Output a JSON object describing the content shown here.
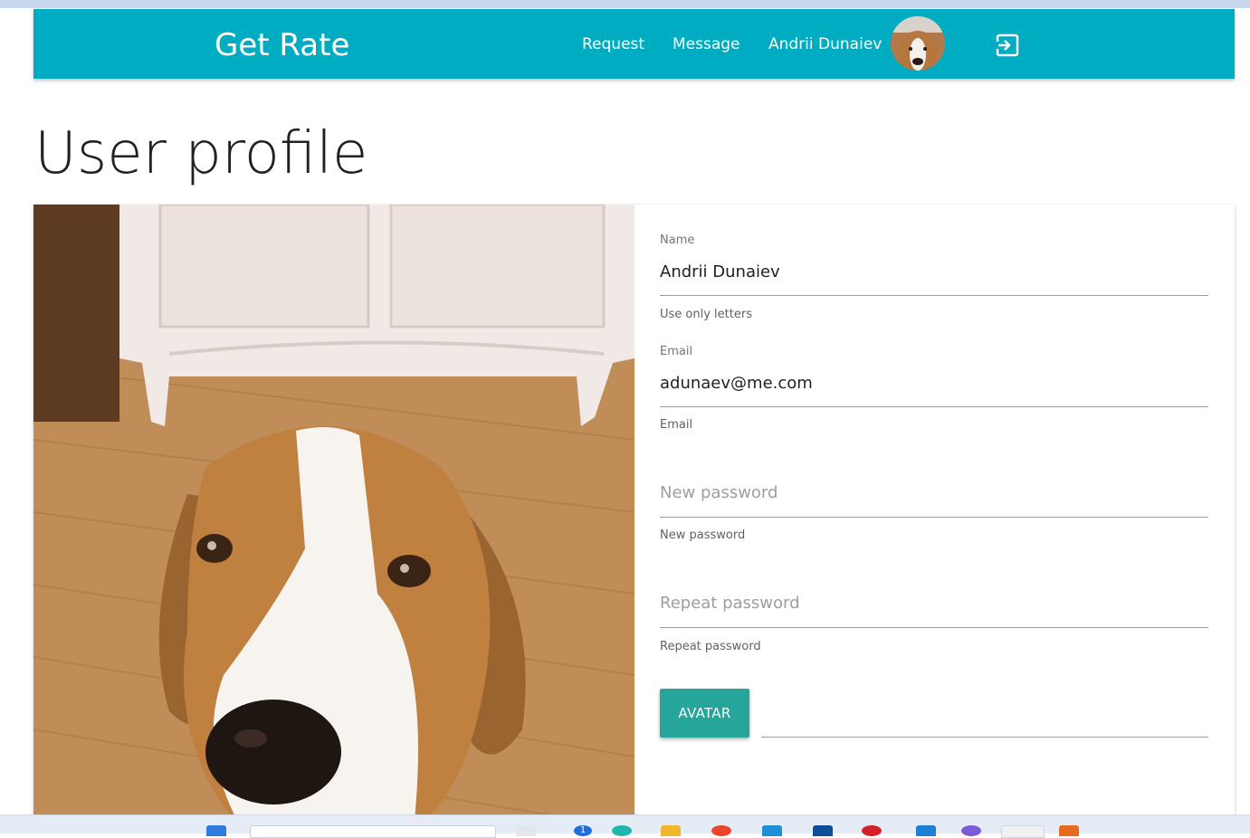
{
  "header": {
    "brand": "Get Rate",
    "nav": {
      "request": "Request",
      "message": "Message",
      "user_name": "Andrii Dunaiev"
    },
    "icons": {
      "avatar": "avatar",
      "logout": "logout-icon"
    },
    "color": "#00acc1"
  },
  "page": {
    "title": "User profile"
  },
  "form": {
    "name": {
      "label": "Name",
      "value": "Andrii Dunaiev",
      "helper": "Use only letters"
    },
    "email": {
      "label": "Email",
      "value": "adunaev@me.com",
      "helper": "Email"
    },
    "new_password": {
      "placeholder": "New password",
      "helper": "New password"
    },
    "repeat_password": {
      "placeholder": "Repeat password",
      "helper": "Repeat password"
    },
    "avatar_button": "AVATAR",
    "button_color": "#26a69a"
  },
  "taskbar": {
    "badge": "1"
  }
}
